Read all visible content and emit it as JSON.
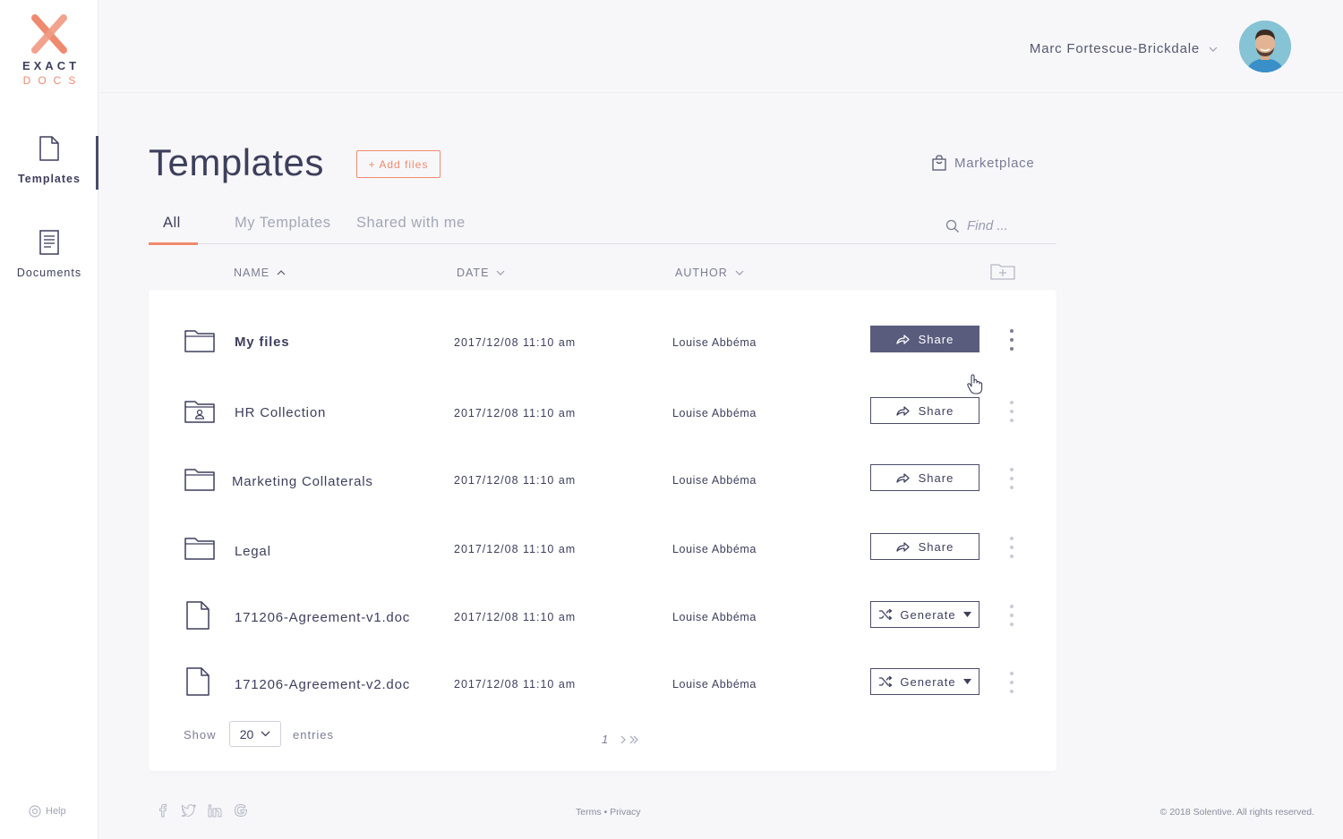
{
  "brand": {
    "line1": "EXACT",
    "line2": "DOCS",
    "accent": "#ef8a6f",
    "ink": "#3d3f5c"
  },
  "sidebar": {
    "items": [
      {
        "label": "Templates",
        "icon": "file-icon",
        "active": true
      },
      {
        "label": "Documents",
        "icon": "document-icon",
        "active": false
      }
    ],
    "help_label": "Help"
  },
  "header": {
    "user_name": "Marc Fortescue-Brickdale"
  },
  "page": {
    "title": "Templates",
    "add_files_label": "+ Add files",
    "marketplace_label": "Marketplace"
  },
  "tabs": [
    {
      "label": "All",
      "active": true
    },
    {
      "label": "My Templates",
      "active": false
    },
    {
      "label": "Shared with me",
      "active": false
    }
  ],
  "search": {
    "placeholder": "Find ..."
  },
  "columns": {
    "name": "NAME",
    "date": "DATE",
    "author": "AUTHOR"
  },
  "rows": [
    {
      "name": "My files",
      "type": "folder",
      "date": "2017/12/08 11:10 am",
      "author": "Louise Abbéma",
      "action": "Share"
    },
    {
      "name": "HR Collection",
      "type": "shared-folder",
      "date": "2017/12/08 11:10 am",
      "author": "Louise Abbéma",
      "action": "Share"
    },
    {
      "name": "Marketing Collaterals",
      "type": "folder",
      "date": "2017/12/08 11:10 am",
      "author": "Louise Abbéma",
      "action": "Share"
    },
    {
      "name": "Legal",
      "type": "folder",
      "date": "2017/12/08 11:10 am",
      "author": "Louise Abbéma",
      "action": "Share"
    },
    {
      "name": "171206-Agreement-v1.doc",
      "type": "file",
      "date": "2017/12/08 11:10 am",
      "author": "Louise Abbéma",
      "action": "Generate"
    },
    {
      "name": "171206-Agreement-v2.doc",
      "type": "file",
      "date": "2017/12/08 11:10 am",
      "author": "Louise Abbéma",
      "action": "Generate"
    }
  ],
  "pagination": {
    "show_label": "Show",
    "page_size": "20",
    "entries_label": "entries",
    "current_page": "1"
  },
  "footer": {
    "terms": "Terms",
    "separator": "•",
    "privacy": "Privacy",
    "copyright": "© 2018  Solentive. All rights reserved."
  }
}
